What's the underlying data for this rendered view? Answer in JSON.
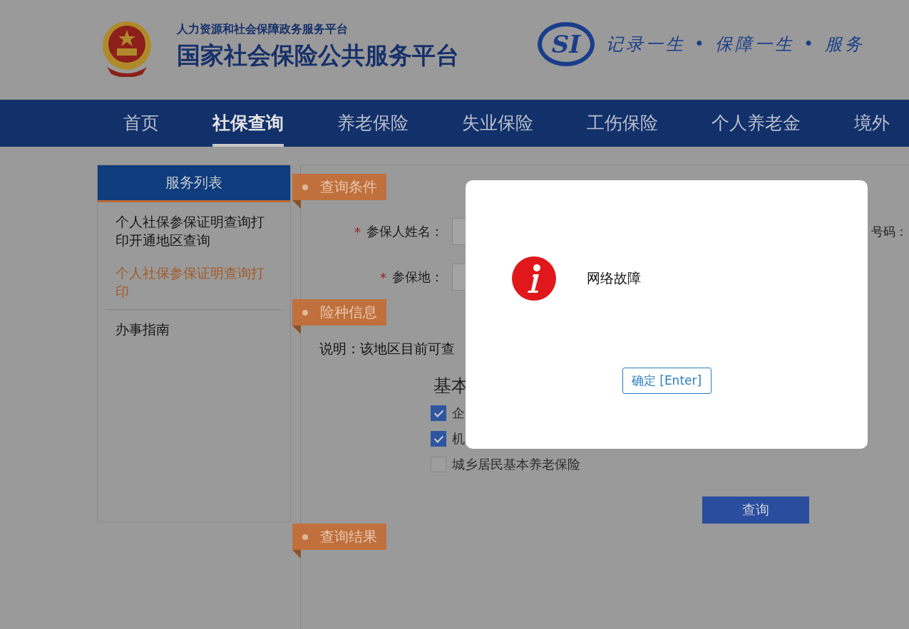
{
  "header": {
    "subtitle": "人力资源和社会保障政务服务平台",
    "title": "国家社会保险公共服务平台",
    "logo_text": "SI",
    "slogan": "记录一生 • 保障一生 • 服务"
  },
  "nav": [
    {
      "label": "首页",
      "selected": false
    },
    {
      "label": "社保查询",
      "selected": true
    },
    {
      "label": "养老保险",
      "selected": false
    },
    {
      "label": "失业保险",
      "selected": false
    },
    {
      "label": "工伤保险",
      "selected": false
    },
    {
      "label": "个人养老金",
      "selected": false
    },
    {
      "label": "境外",
      "selected": false
    }
  ],
  "sidebar": {
    "title": "服务列表",
    "items": [
      {
        "label": "个人社保参保证明查询打印开通地区查询",
        "selected": false
      },
      {
        "label": "个人社保参保证明查询打印",
        "selected": true
      },
      {
        "label": "办事指南",
        "selected": false
      }
    ]
  },
  "query_conditions": {
    "title": "查询条件",
    "fields": [
      {
        "required_mark": "*",
        "label": "参保人姓名："
      },
      {
        "required_mark": "*",
        "label": "参保地："
      }
    ],
    "right_label": "号码："
  },
  "insurance_info": {
    "title": "险种信息",
    "note": "说明：该地区目前可查",
    "group_title": "基本",
    "options": [
      {
        "label": "企",
        "checked": true
      },
      {
        "label": "机",
        "checked": true
      },
      {
        "label": "城乡居民基本养老保险",
        "checked": false
      }
    ],
    "button": "查询"
  },
  "results": {
    "title": "查询结果"
  },
  "dialog": {
    "message": "网络故障",
    "button": "确定 [Enter]"
  }
}
